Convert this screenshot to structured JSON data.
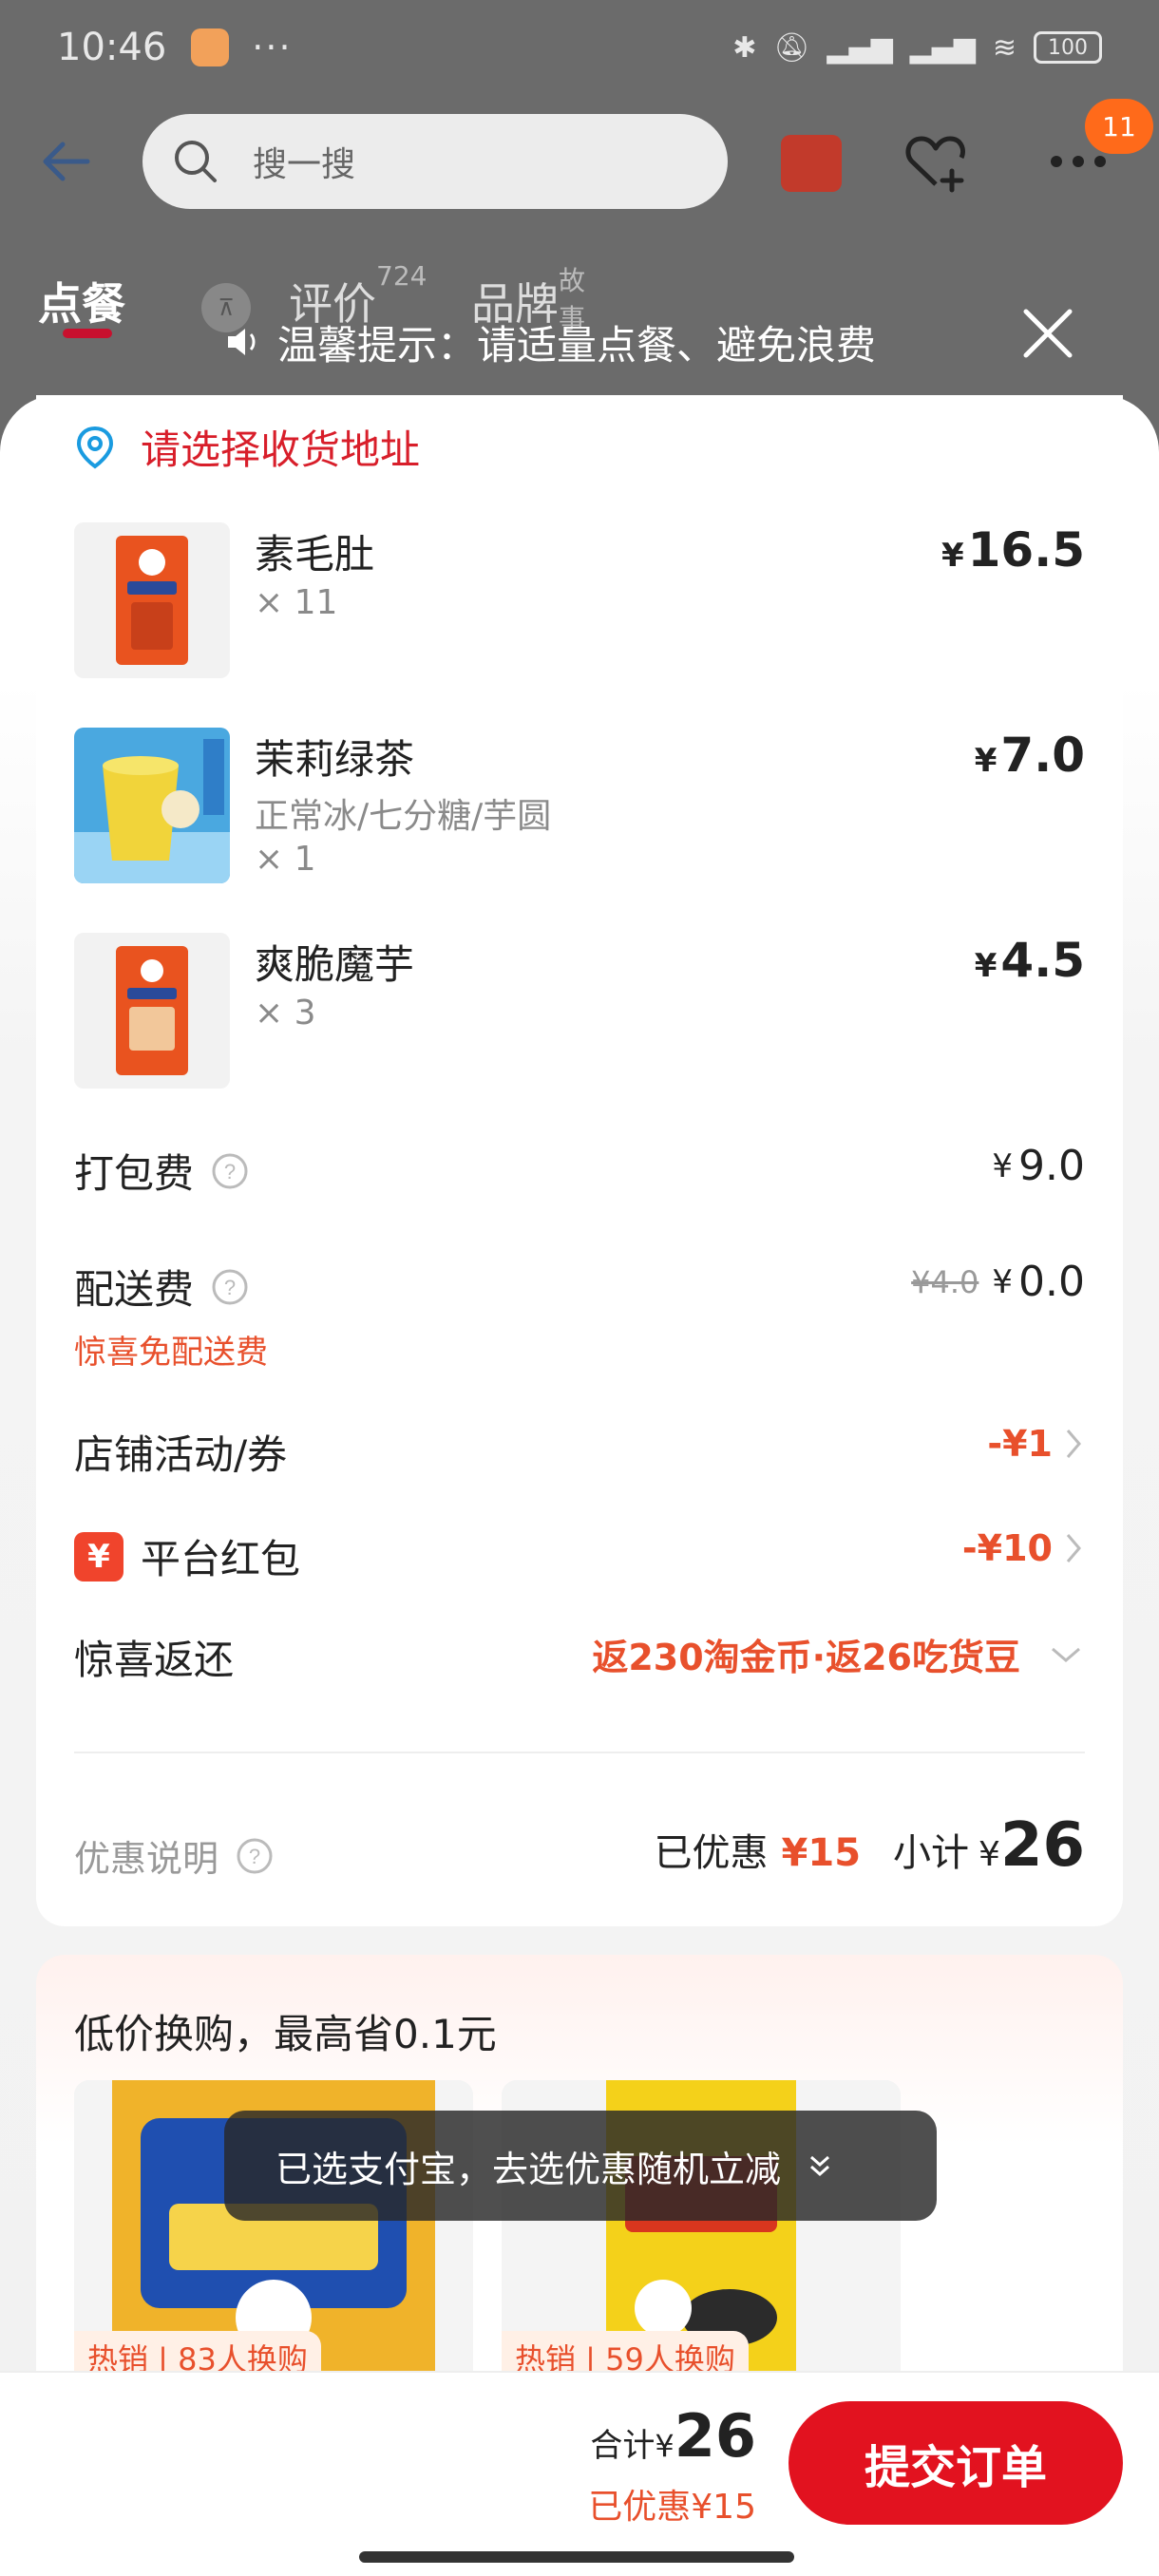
{
  "status_bar": {
    "time": "10:46",
    "more": "···",
    "battery": "100"
  },
  "header": {
    "search_placeholder": "搜一搜",
    "notification_count": "11"
  },
  "tabs": [
    {
      "label": "点餐"
    },
    {
      "label": "评价",
      "sup": "724"
    },
    {
      "label": "品牌",
      "sup": "故事"
    }
  ],
  "notice": {
    "text": "温馨提示：请适量点餐、避免浪费"
  },
  "address": {
    "prompt": "请选择收货地址"
  },
  "items": [
    {
      "name": "素毛肚",
      "spec": "",
      "qty": "× 11",
      "price": "16.5"
    },
    {
      "name": "茉莉绿茶",
      "spec": "正常冰/七分糖/芋圆",
      "qty": "× 1",
      "price": "7.0"
    },
    {
      "name": "爽脆魔芋",
      "spec": "",
      "qty": "× 3",
      "price": "4.5"
    }
  ],
  "fees": {
    "packing_label": "打包费",
    "packing_value": "9.0",
    "delivery_label": "配送费",
    "delivery_original": "¥4.0",
    "delivery_value": "0.0",
    "delivery_note": "惊喜免配送费"
  },
  "promos": {
    "shop_label": "店铺活动/券",
    "shop_value": "-¥1",
    "platform_label": "平台红包",
    "platform_icon": "¥",
    "platform_value": "-¥10",
    "rebate_label": "惊喜返还",
    "rebate_value": "返230淘金币·返26吃货豆"
  },
  "summary": {
    "discount_note": "优惠说明",
    "saved_label": "已优惠",
    "saved_value": "¥15",
    "subtotal_label": "小计",
    "subtotal_value": "26"
  },
  "exchange": {
    "title": "低价换购，最高省0.1元",
    "cards": [
      {
        "tag": "热销 | 83人换购"
      },
      {
        "tag": "热销 | 59人换购"
      }
    ]
  },
  "toast": {
    "text": "已选支付宝，去选优惠随机立减"
  },
  "bottom": {
    "total_label": "合计",
    "total_value": "26",
    "saved_text": "已优惠¥15",
    "submit_label": "提交订单"
  },
  "colors": {
    "accent_red": "#e2121f",
    "discount_orange": "#e8502c",
    "address_red": "#d81e2a"
  }
}
